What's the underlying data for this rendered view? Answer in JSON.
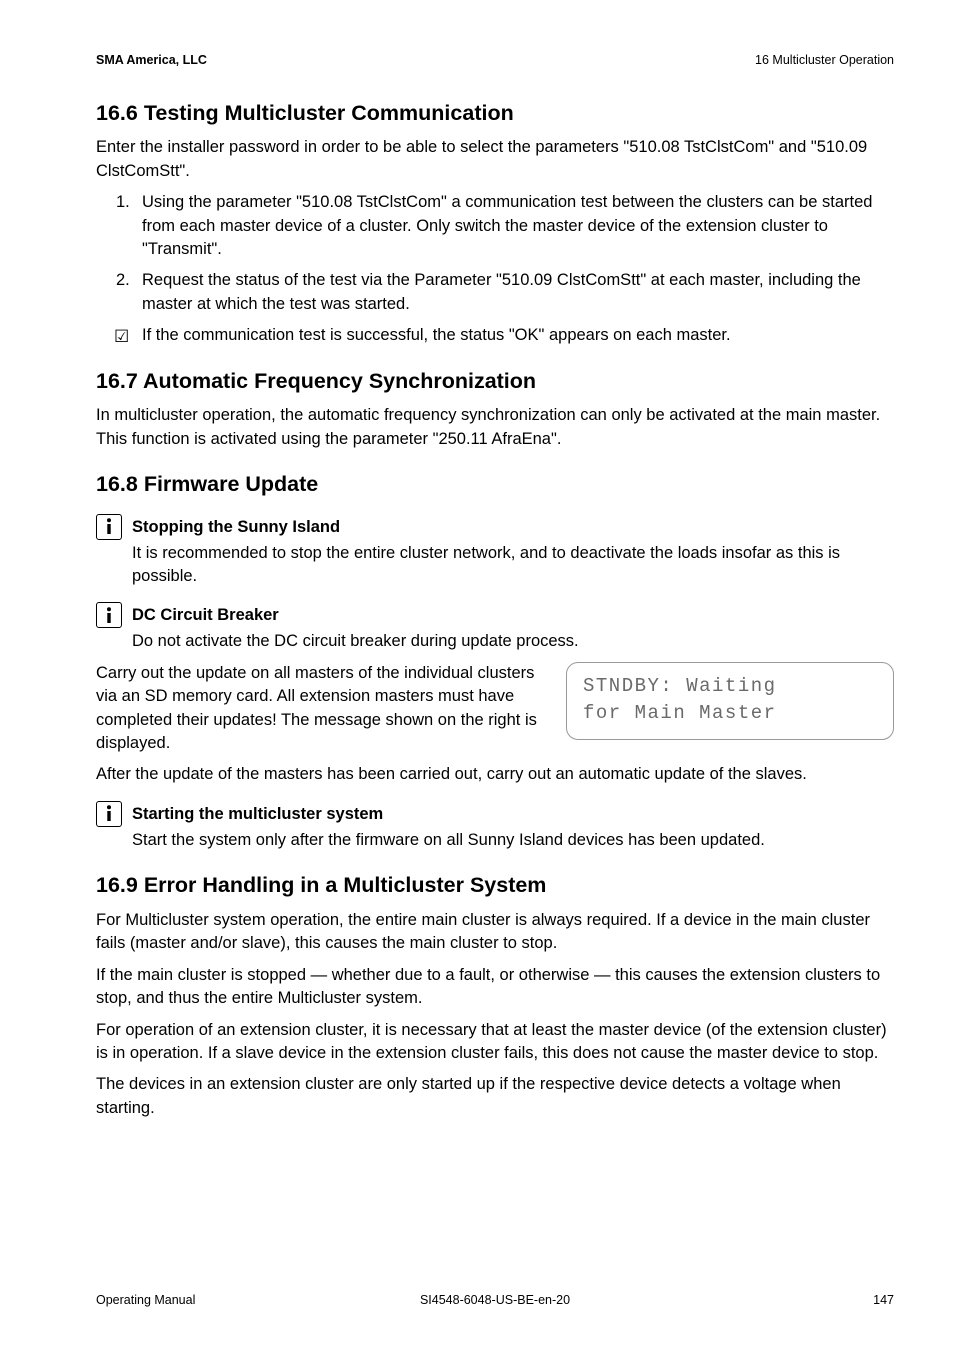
{
  "header": {
    "left": "SMA America, LLC",
    "right": "16  Multicluster Operation"
  },
  "sec_16_6": {
    "title": "16.6 Testing Multicluster Communication",
    "intro": "Enter the installer password in order to be able to select the parameters \"510.08 TstClstCom\" and \"510.09 ClstComStt\".",
    "step1_num": "1.",
    "step1": "Using the parameter \"510.08 TstClstCom\" a communication test between the clusters can be started from each master device of a cluster. Only switch the master device of the extension cluster to \"Transmit\".",
    "step2_num": "2.",
    "step2": "Request the status of the test via the Parameter \"510.09 ClstComStt\" at each master, including the master at which the test was started.",
    "check": "If the communication test is successful, the status \"OK\" appears on each master."
  },
  "sec_16_7": {
    "title": "16.7 Automatic Frequency Synchronization",
    "body": "In multicluster operation, the automatic frequency synchronization can only be activated at the main master. This function is activated using the parameter \"250.11 AfraEna\"."
  },
  "sec_16_8": {
    "title": "16.8 Firmware Update",
    "info1_title": "Stopping the Sunny Island",
    "info1_body": "It is recommended to stop the entire cluster network, and to deactivate the loads insofar as this is possible.",
    "info2_title": "DC Circuit Breaker",
    "info2_body": "Do not activate the DC circuit breaker during update process.",
    "para_left": "Carry out the update on all masters of the individual clusters via an SD memory card. All extension masters must have completed their updates! The message shown on the right is displayed.",
    "lcd_line1": "STNDBY: Waiting",
    "lcd_line2": "for Main Master",
    "after_p": "After the update of the masters has been carried out, carry out an automatic update of the slaves.",
    "info3_title": "Starting the multicluster system",
    "info3_body": "Start the system only after the firmware on all Sunny Island devices has been updated."
  },
  "sec_16_9": {
    "title": "16.9 Error Handling in a Multicluster System",
    "p1": "For Multicluster system operation, the entire main cluster is always required. If a device in the main cluster fails (master and/or slave), this causes the main cluster to stop.",
    "p2": "If the main cluster is stopped — whether due to a fault, or otherwise — this causes the extension clusters to stop, and thus the entire Multicluster system.",
    "p3": "For operation of an extension cluster, it is necessary that at least the master device (of the extension cluster) is in operation. If a slave device in the extension cluster fails, this does not cause the master device to stop.",
    "p4": "The devices in an extension cluster are only started up if the respective device detects a voltage when starting."
  },
  "footer": {
    "left": "Operating Manual",
    "center": "SI4548-6048-US-BE-en-20",
    "right": "147"
  },
  "glyphs": {
    "checkbox": "☑"
  }
}
